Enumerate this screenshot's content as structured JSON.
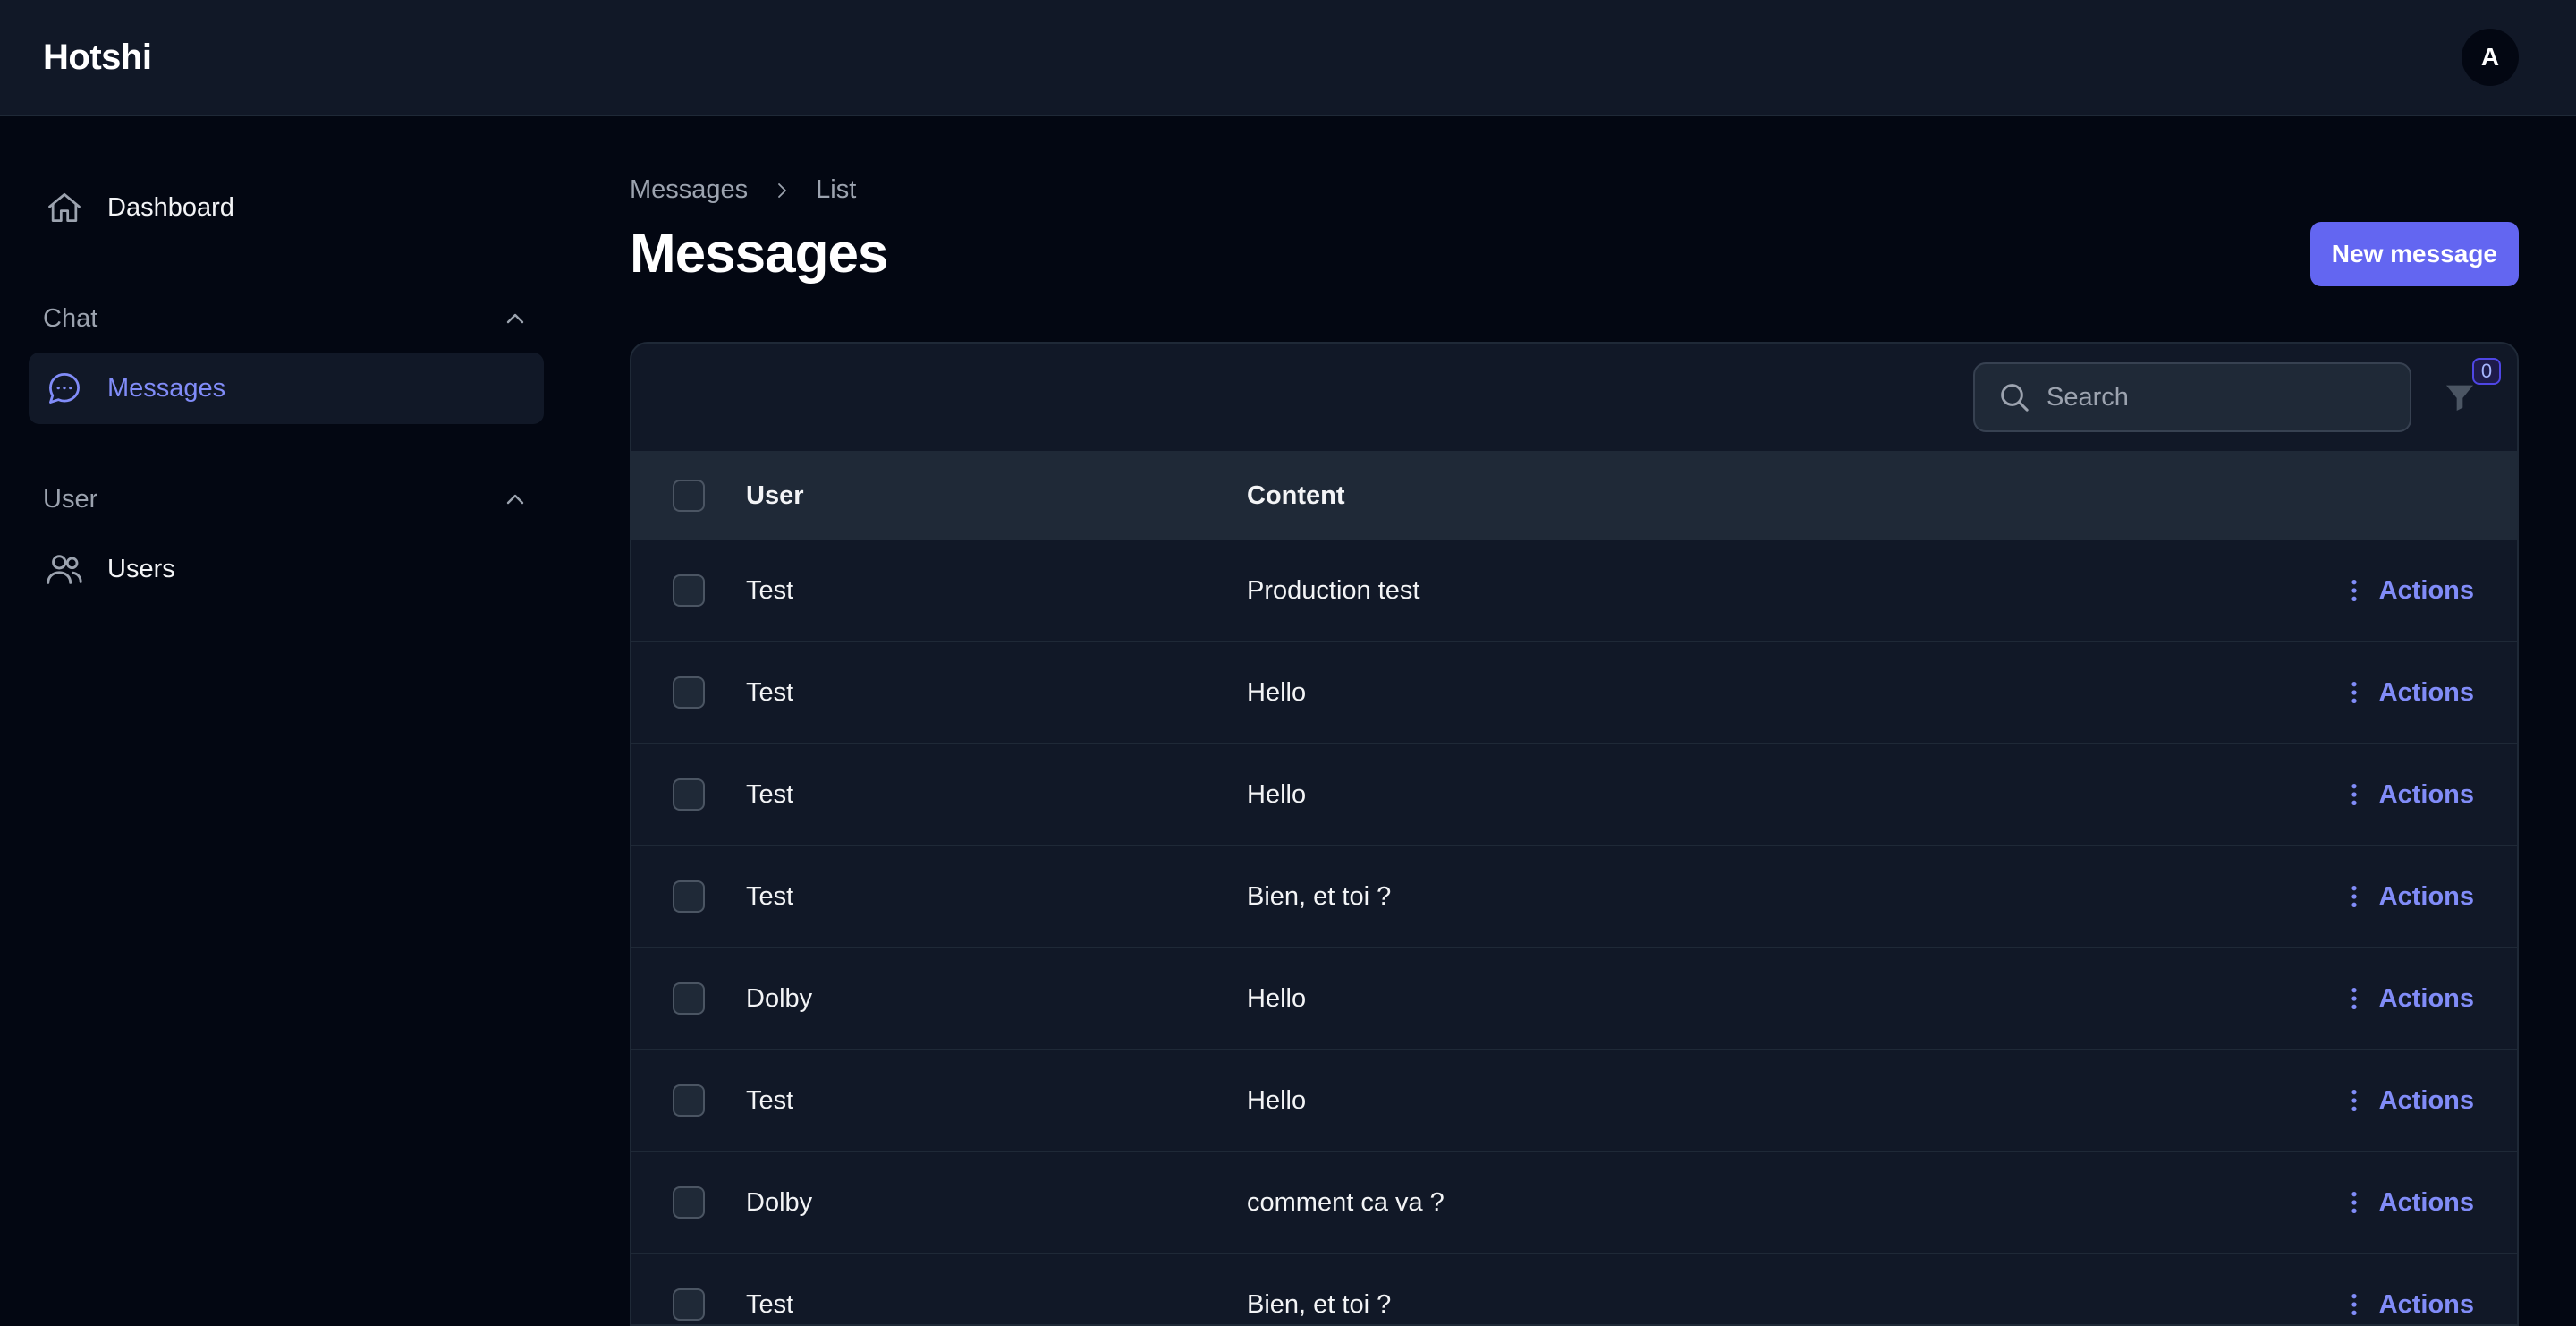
{
  "app": {
    "brand": "Hotshi",
    "avatar_initial": "A"
  },
  "sidebar": {
    "dashboard": {
      "label": "Dashboard",
      "icon": "home-icon"
    },
    "groups": [
      {
        "title": "Chat",
        "items": [
          {
            "label": "Messages",
            "icon": "chat-bubble-icon",
            "active": true
          }
        ]
      },
      {
        "title": "User",
        "items": [
          {
            "label": "Users",
            "icon": "users-icon",
            "active": false
          }
        ]
      }
    ]
  },
  "breadcrumb": {
    "items": [
      "Messages",
      "List"
    ]
  },
  "page": {
    "title": "Messages",
    "primary_action": "New message"
  },
  "table": {
    "search_placeholder": "Search",
    "filter_count": "0",
    "columns": {
      "user": "User",
      "content": "Content"
    },
    "action_label": "Actions",
    "rows": [
      {
        "user": "Test",
        "content": "Production test"
      },
      {
        "user": "Test",
        "content": "Hello"
      },
      {
        "user": "Test",
        "content": "Hello"
      },
      {
        "user": "Test",
        "content": "Bien, et toi ?"
      },
      {
        "user": "Dolby",
        "content": "Hello"
      },
      {
        "user": "Test",
        "content": "Hello"
      },
      {
        "user": "Dolby",
        "content": "comment ca va ?"
      },
      {
        "user": "Test",
        "content": "Bien, et toi ?"
      }
    ]
  },
  "colors": {
    "accent": "#6366f1",
    "accent_text": "#818cf8",
    "background": "#030712",
    "surface": "#111827"
  }
}
